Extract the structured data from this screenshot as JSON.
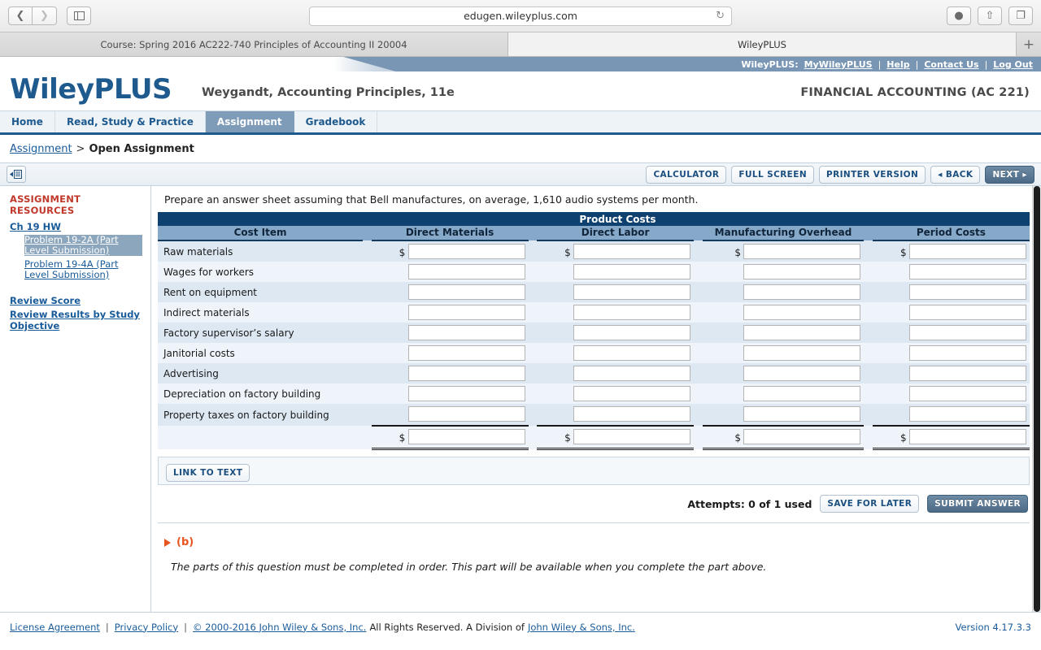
{
  "browser": {
    "url": "edugen.wileyplus.com",
    "back_icon": "chevron-left-icon",
    "forward_icon": "chevron-right-icon",
    "sidebar_icon": "sidebar-toggle-icon",
    "reload_icon": "reload-icon",
    "download_icon": "download-icon",
    "share_icon": "share-icon",
    "tabs_icon": "show-tabs-icon",
    "new_tab_label": "+",
    "tabs": [
      {
        "label": "Course: Spring 2016 AC222-740 Principles of Accounting II 20004",
        "active": false
      },
      {
        "label": "WileyPLUS",
        "active": true
      }
    ]
  },
  "header": {
    "logo": "WileyPLUS",
    "book_title": "Weygandt, Accounting Principles, 11e",
    "course_title": "FINANCIAL ACCOUNTING (AC 221)",
    "topnav_prefix": "WileyPLUS:",
    "topnav": [
      "MyWileyPLUS",
      "Help",
      "Contact Us",
      "Log Out"
    ],
    "topnav_separator": "|"
  },
  "nav": {
    "items": [
      {
        "label": "Home",
        "active": false
      },
      {
        "label": "Read, Study & Practice",
        "active": false
      },
      {
        "label": "Assignment",
        "active": true
      },
      {
        "label": "Gradebook",
        "active": false
      }
    ]
  },
  "breadcrumb": {
    "parent": "Assignment",
    "separator": ">",
    "current": "Open Assignment"
  },
  "toolbar": {
    "panel_icon": "collapse-panel-icon",
    "calculator": "CALCULATOR",
    "full_screen": "FULL SCREEN",
    "printer_version": "PRINTER VERSION",
    "back": "◂ BACK",
    "next": "NEXT ▸"
  },
  "sidebar": {
    "title": "ASSIGNMENT RESOURCES",
    "chapter": "Ch 19 HW",
    "problems": [
      {
        "label": "Problem 19-2A (Part Level Submission)",
        "selected": true
      },
      {
        "label": "Problem 19-4A (Part Level Submission)",
        "selected": false
      }
    ],
    "links": [
      "Review Score",
      "Review Results by Study Objective"
    ]
  },
  "question": {
    "prompt": "Prepare an answer sheet assuming that Bell manufactures, on average, 1,610 audio systems per month."
  },
  "table": {
    "group_header": "Product Costs",
    "columns": [
      "Cost Item",
      "Direct Materials",
      "Direct Labor",
      "Manufacturing Overhead",
      "Period Costs"
    ],
    "rows": [
      "Raw materials",
      "Wages for workers",
      "Rent on equipment",
      "Indirect materials",
      "Factory supervisor’s salary",
      "Janitorial costs",
      "Advertising",
      "Depreciation on factory building",
      "Property taxes on factory building"
    ],
    "total_row_label": "",
    "dollar_sign": "$",
    "input_value": "",
    "input_placeholder": ""
  },
  "actions": {
    "link_to_text": "LINK TO TEXT",
    "attempts": "Attempts: 0 of 1 used",
    "save_for_later": "SAVE FOR LATER",
    "submit_answer": "SUBMIT ANSWER"
  },
  "part_b": {
    "label": "(b)",
    "arrow_icon": "expand-arrow-icon",
    "note": "The parts of this question must be completed in order. This part will be available when you complete the part above."
  },
  "footer": {
    "license": "License Agreement",
    "privacy": "Privacy Policy",
    "copyright": "© 2000-2016 John Wiley & Sons, Inc.",
    "rights": "All Rights Reserved. A Division of",
    "division": "John Wiley & Sons, Inc.",
    "version": "Version 4.17.3.3",
    "separator": "|"
  },
  "colors": {
    "brand_blue": "#1e5a8e",
    "table_header_dark": "#0f4170",
    "table_header_light": "#86a9c9",
    "accent_orange": "#e8541f",
    "sidebar_title_red": "#c0392b"
  }
}
